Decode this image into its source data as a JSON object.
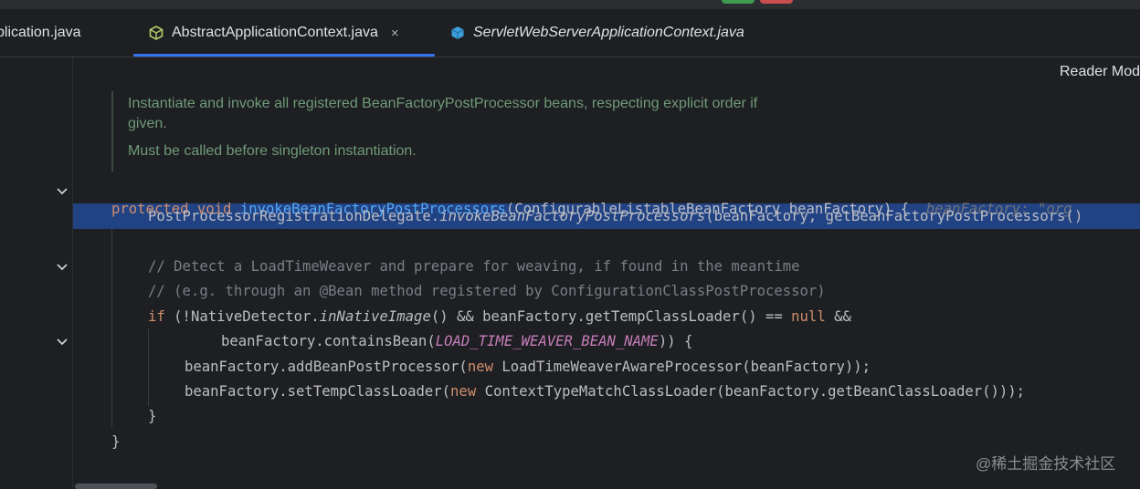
{
  "tabs": [
    {
      "label": "plication.java",
      "active": false
    },
    {
      "label": "AbstractApplicationContext.java",
      "active": true,
      "close": "×"
    },
    {
      "label": "ServletWebServerApplicationContext.java",
      "active": false
    }
  ],
  "reader_mode": "Reader Mod",
  "doc": {
    "line1": "Instantiate and invoke all registered BeanFactoryPostProcessor beans, respecting explicit order if",
    "line2": "given.",
    "line3": "Must be called before singleton instantiation."
  },
  "code": {
    "l1_kw1": "protected",
    "l1_kw2": "void",
    "l1_fn": "invokeBeanFactoryPostProcessors",
    "l1_rest": "(ConfigurableListableBeanFactory beanFactory) {",
    "l1_hint": "beanFactory: \"org",
    "l2_a": "PostProcessorRegistrationDelegate.",
    "l2_b": "invokeBeanFactoryPostProcessors",
    "l2_c": "(beanFactory, getBeanFactoryPostProcessors()",
    "l3": "// Detect a LoadTimeWeaver and prepare for weaving, if found in the meantime",
    "l4": "// (e.g. through an @Bean method registered by ConfigurationClassPostProcessor)",
    "l5_if": "if",
    "l5_a": " (!NativeDetector.",
    "l5_b": "inNativeImage",
    "l5_c": "() && beanFactory.getTempClassLoader() == ",
    "l5_null": "null",
    "l5_d": " &&",
    "l6_a": "beanFactory.containsBean(",
    "l6_const": "LOAD_TIME_WEAVER_BEAN_NAME",
    "l6_b": ")) {",
    "l7_a": "beanFactory.addBeanPostProcessor(",
    "l7_new": "new",
    "l7_b": " LoadTimeWeaverAwareProcessor(beanFactory));",
    "l8_a": "beanFactory.setTempClassLoader(",
    "l8_new": "new",
    "l8_b": " ContextTypeMatchClassLoader(beanFactory.getBeanClassLoader()));",
    "l9": "}",
    "l10": "}"
  },
  "watermark": "@稀土掘金技术社区",
  "colors": {
    "accent": "#3574f0",
    "highlight": "#214283",
    "keyword": "#cf8e6d",
    "function": "#56a8f5"
  }
}
